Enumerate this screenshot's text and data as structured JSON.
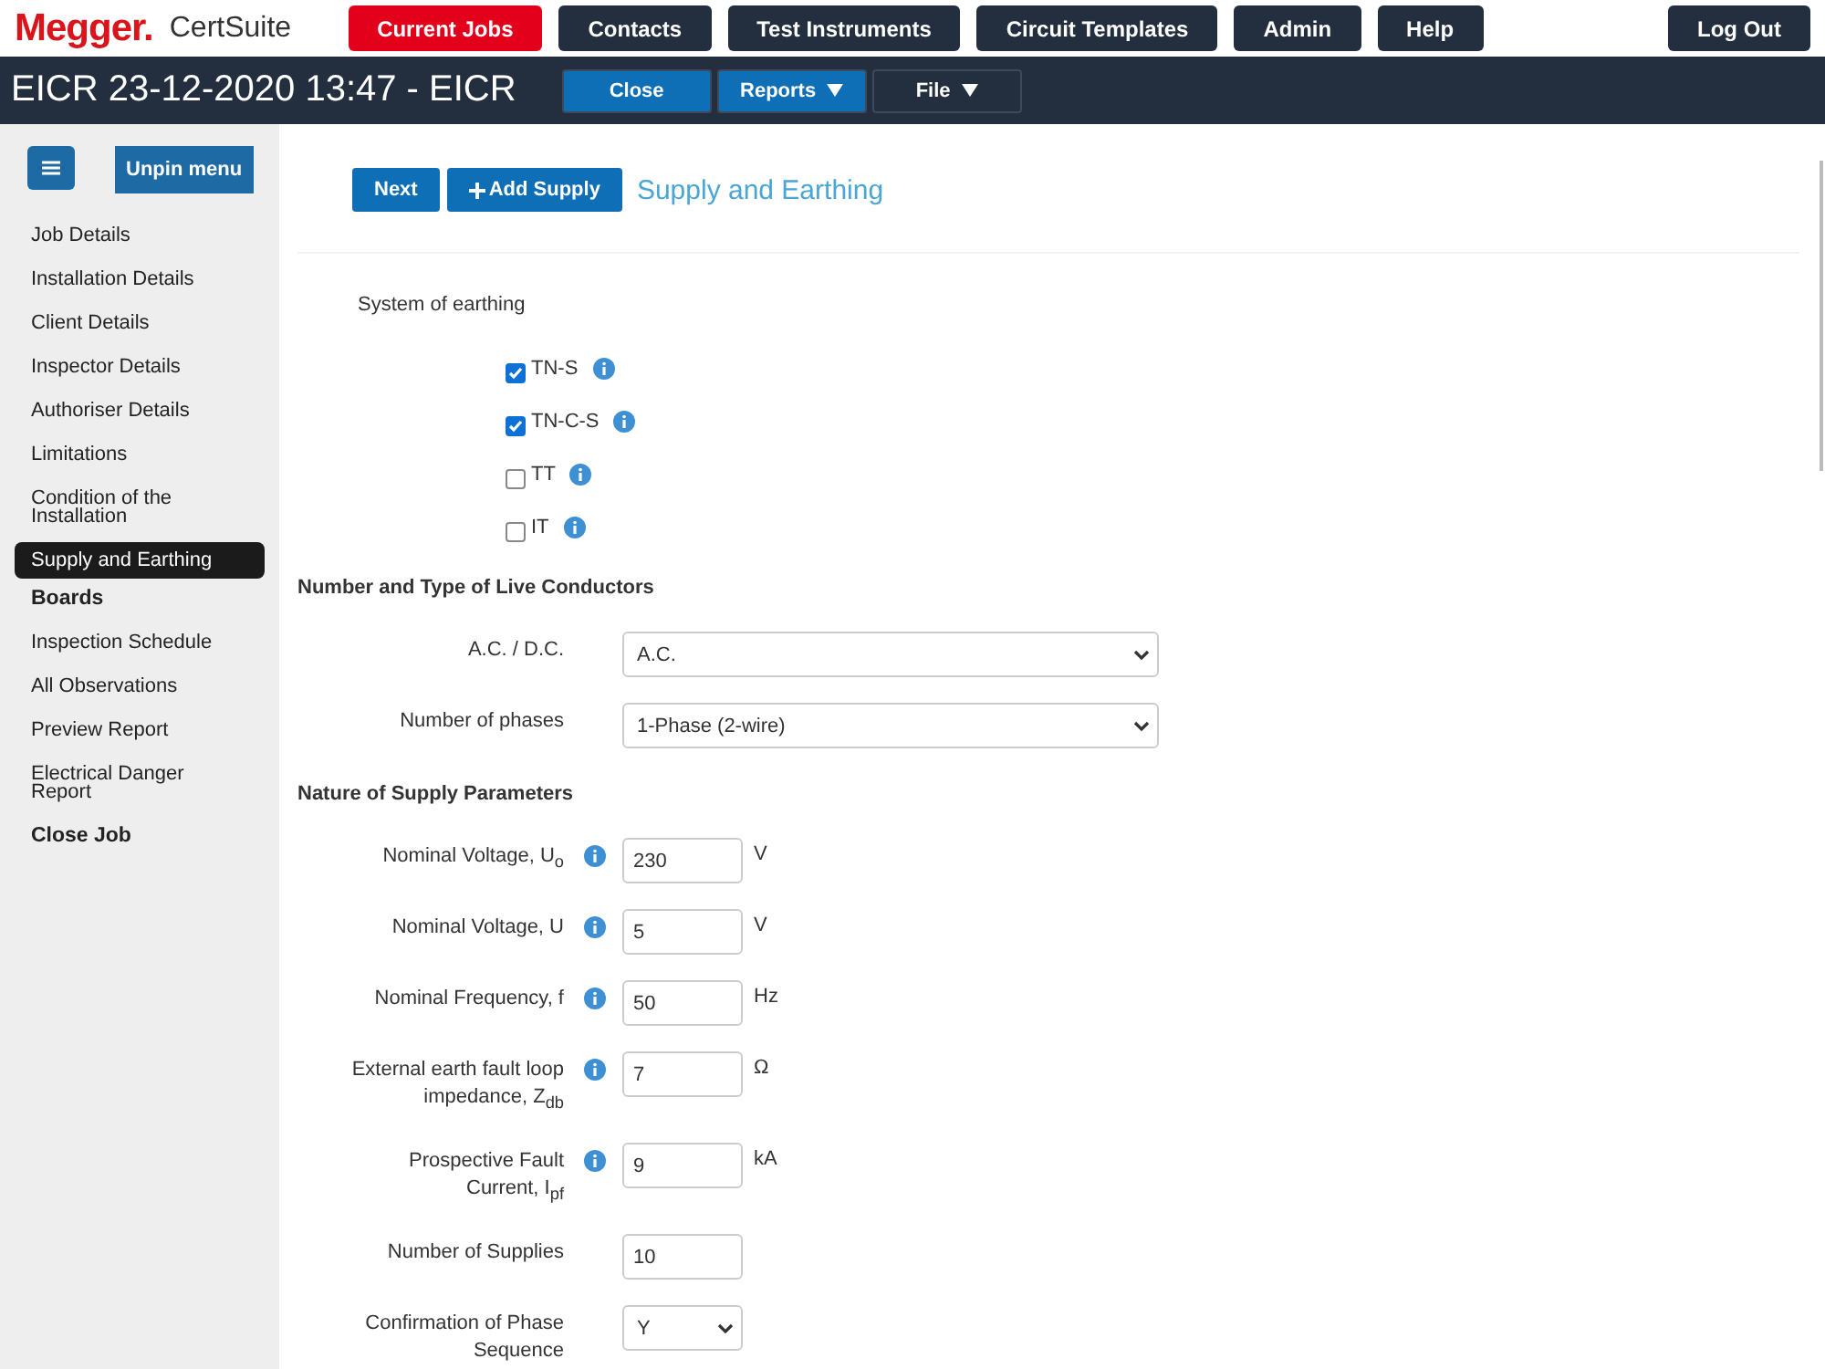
{
  "brand": {
    "logo": "Megger.",
    "product": "CertSuite"
  },
  "nav": [
    {
      "label": "Current Jobs",
      "selected": true
    },
    {
      "label": "Contacts",
      "selected": false
    },
    {
      "label": "Test Instruments",
      "selected": false
    },
    {
      "label": "Circuit Templates",
      "selected": false
    },
    {
      "label": "Admin",
      "selected": false
    },
    {
      "label": "Help",
      "selected": false
    }
  ],
  "logout": "Log Out",
  "job": {
    "title": "EICR 23-12-2020 13:47 - EICR",
    "actions": [
      {
        "label": "Close",
        "dropdown": false,
        "selected": true
      },
      {
        "label": "Reports",
        "dropdown": true,
        "selected": true
      },
      {
        "label": "File",
        "dropdown": true,
        "selected": false
      }
    ]
  },
  "sidebar": {
    "unpin": "Unpin menu",
    "items": [
      {
        "label": "Job Details",
        "bold": false,
        "selected": false
      },
      {
        "label": "Installation Details",
        "bold": false,
        "selected": false
      },
      {
        "label": "Client Details",
        "bold": false,
        "selected": false
      },
      {
        "label": "Inspector Details",
        "bold": false,
        "selected": false
      },
      {
        "label": "Authoriser Details",
        "bold": false,
        "selected": false
      },
      {
        "label": "Limitations",
        "bold": false,
        "selected": false
      },
      {
        "label": "Condition of the Installation",
        "bold": false,
        "selected": false
      },
      {
        "label": "Supply and Earthing",
        "bold": false,
        "selected": true
      },
      {
        "label": "Boards",
        "bold": true,
        "selected": false
      },
      {
        "label": "Inspection Schedule",
        "bold": false,
        "selected": false
      },
      {
        "label": "All Observations",
        "bold": false,
        "selected": false
      },
      {
        "label": "Preview Report",
        "bold": false,
        "selected": false
      },
      {
        "label": "Electrical Danger Report",
        "bold": false,
        "selected": false
      },
      {
        "label": "Close Job",
        "bold": true,
        "selected": false
      }
    ]
  },
  "toolbar": {
    "buttons": [
      {
        "label": "Next",
        "icon": false
      },
      {
        "label": "Add Supply",
        "icon": true
      }
    ],
    "heading": "Supply and Earthing"
  },
  "earthing": {
    "label": "System of earthing",
    "options": [
      {
        "label": "TN-S",
        "checked": true
      },
      {
        "label": "TN-C-S",
        "checked": true
      },
      {
        "label": "TT",
        "checked": false
      },
      {
        "label": "IT",
        "checked": false
      }
    ]
  },
  "conductors": {
    "heading": "Number and Type of Live Conductors",
    "fields": [
      {
        "label": "A.C. / D.C.",
        "value": "A.C."
      },
      {
        "label": "Number of phases",
        "value": "1-Phase (2-wire)"
      }
    ]
  },
  "supply": {
    "heading": "Nature of Supply Parameters",
    "fields": [
      {
        "kind": "input",
        "label": "Nominal Voltage, U$_{o}$",
        "info": true,
        "value": "230",
        "unit": "V"
      },
      {
        "kind": "input",
        "label": "Nominal Voltage, U",
        "info": true,
        "value": "5",
        "unit": "V"
      },
      {
        "kind": "input",
        "label": "Nominal Frequency, f",
        "info": true,
        "value": "50",
        "unit": "Hz"
      },
      {
        "kind": "input",
        "label": "External earth fault loop impedance, Z$_{db}$",
        "info": true,
        "value": "7",
        "unit": "Ω"
      },
      {
        "kind": "input",
        "label": "Prospective Fault Current, I$_{pf}$",
        "info": true,
        "value": "9",
        "unit": "kA"
      },
      {
        "kind": "input",
        "label": "Number of Supplies",
        "info": false,
        "value": "10"
      },
      {
        "kind": "select",
        "label": "Confirmation of Phase Sequence",
        "info": false,
        "value": "Y"
      }
    ]
  }
}
